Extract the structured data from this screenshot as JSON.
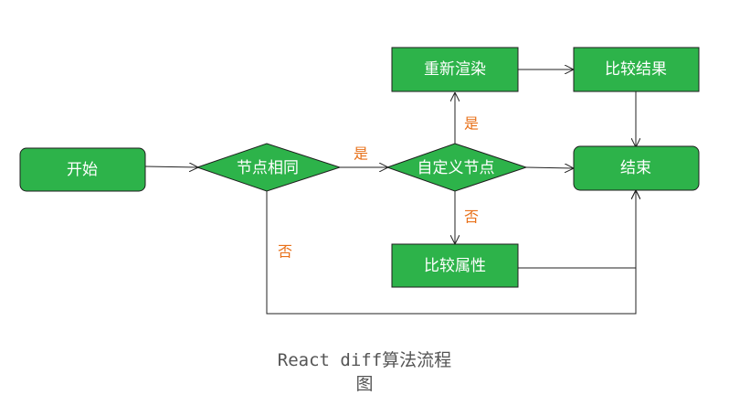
{
  "colors": {
    "node_fill": "#2db34a",
    "node_stroke": "#1e1e1e",
    "edge": "#222222",
    "edge_label": "#e8711a"
  },
  "nodes": {
    "start": "开始",
    "same_node": "节点相同",
    "custom_node": "自定义节点",
    "rerender": "重新渲染",
    "compare_result": "比较结果",
    "end": "结束",
    "compare_props": "比较属性"
  },
  "edge_labels": {
    "same_yes": "是",
    "same_no": "否",
    "custom_yes": "是",
    "custom_no": "否"
  },
  "caption": {
    "line1": "React diff算法流程",
    "line2": "图"
  }
}
